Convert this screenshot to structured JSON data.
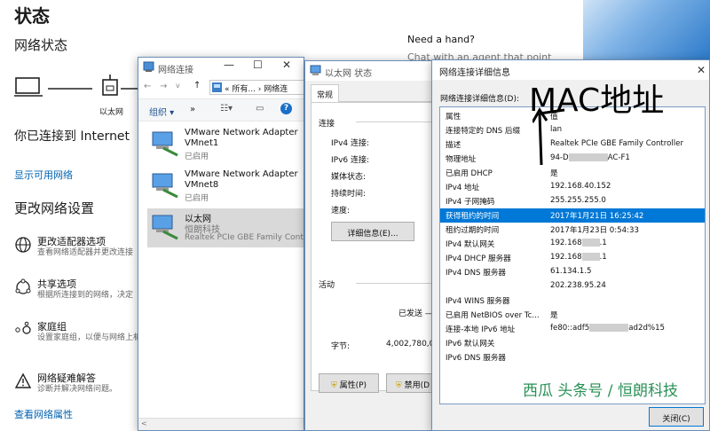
{
  "settings": {
    "title": "状态",
    "network_status": "网络状态",
    "adapter_caption": "以太网",
    "connected_text": "你已连接到 Internet",
    "show_networks": "显示可用网络",
    "change_settings": "更改网络设置",
    "options": [
      {
        "title": "更改适配器选项",
        "sub": "查看网络适配器并更改连接"
      },
      {
        "title": "共享选项",
        "sub": "根据所连接到的网络，决定"
      },
      {
        "title": "家庭组",
        "sub": "设置家庭组，以便与网络上机。"
      },
      {
        "title": "网络疑难解答",
        "sub": "诊断并解决网络问题。"
      }
    ],
    "view_props": "查看网络属性",
    "help_title": "Need a hand?",
    "help_sub": "Chat with an agent that point"
  },
  "netconn": {
    "title": "网络连接",
    "min": "—",
    "max": "☐",
    "close": "✕",
    "address": "« 所有... › 网络连",
    "organize": "组织 ▾",
    "more": "»",
    "adapters": [
      {
        "name": "VMware Network Adapter",
        "name2": "VMnet1",
        "status": "已启用"
      },
      {
        "name": "VMware Network Adapter",
        "name2": "VMnet8",
        "status": "已启用"
      },
      {
        "name": "以太网",
        "name2": "恒朗科技",
        "status": "Realtek PCIe GBE Family Contr"
      }
    ]
  },
  "ethstatus": {
    "title": "以太网 状态",
    "tab_general": "常规",
    "group_connection": "连接",
    "rows": [
      "IPv4 连接:",
      "IPv6 连接:",
      "媒体状态:",
      "持续时间:",
      "速度:"
    ],
    "details_button": "详细信息(E)...",
    "group_activity": "活动",
    "sent": "已发送 —",
    "bytes_label": "字节:",
    "bytes_value": "4,002,780,0",
    "props_button": "属性(P)",
    "disable_button": "禁用(D"
  },
  "details": {
    "title": "网络连接详细信息",
    "label": "网络连接详细信息(D):",
    "close": "✕",
    "header_k": "属性",
    "header_v": "值",
    "rows": [
      {
        "k": "连接特定的 DNS 后缀",
        "v": "lan"
      },
      {
        "k": "描述",
        "v": "Realtek PCIe GBE Family Controller"
      },
      {
        "k": "物理地址",
        "v": "94-D",
        "v2": "AC-F1"
      },
      {
        "k": "已启用 DHCP",
        "v": "是"
      },
      {
        "k": "IPv4 地址",
        "v": "192.168.40.152"
      },
      {
        "k": "IPv4 子网掩码",
        "v": "255.255.255.0"
      },
      {
        "k": "获得租约的时间",
        "v": "2017年1月21日 16:25:42"
      },
      {
        "k": "租约过期的时间",
        "v": "2017年1月23日 0:54:33"
      },
      {
        "k": "IPv4 默认网关",
        "v": "192.168",
        "v2": ".1"
      },
      {
        "k": "IPv4 DHCP 服务器",
        "v": "192.168",
        "v2": ".1"
      },
      {
        "k": "IPv4 DNS 服务器",
        "v": "61.134.1.5"
      },
      {
        "k": "",
        "v": "202.238.95.24"
      },
      {
        "k": "IPv4 WINS 服务器",
        "v": ""
      },
      {
        "k": "已启用 NetBIOS over Tc...",
        "v": "是"
      },
      {
        "k": "连接-本地 IPv6 地址",
        "v": "fe80::adf5",
        "v2": "ad2d%15"
      },
      {
        "k": "IPv6 默认网关",
        "v": ""
      },
      {
        "k": "IPv6 DNS 服务器",
        "v": ""
      }
    ],
    "close_button": "关闭(C)"
  },
  "annotation": "MAC地址",
  "watermark": "西瓜 头条号 / 恒朗科技"
}
